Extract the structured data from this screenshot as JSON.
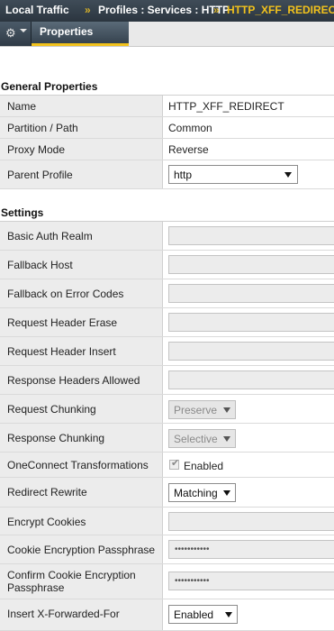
{
  "breadcrumb": {
    "root": "Local Traffic",
    "sep1": "»",
    "section": "Profiles : Services : HTTP",
    "sep2": "»",
    "current": "HTTP_XFF_REDIRECT"
  },
  "toolbar": {
    "gear_icon": "gear-icon",
    "gear_glyph": "⚙",
    "active_tab": "Properties"
  },
  "general": {
    "title": "General Properties",
    "name_label": "Name",
    "name_value": "HTTP_XFF_REDIRECT",
    "partition_label": "Partition / Path",
    "partition_value": "Common",
    "proxy_label": "Proxy Mode",
    "proxy_value": "Reverse",
    "parent_label": "Parent Profile",
    "parent_value": "http"
  },
  "settings": {
    "title": "Settings",
    "basic_auth_label": "Basic Auth Realm",
    "basic_auth_value": "",
    "fallback_host_label": "Fallback Host",
    "fallback_host_value": "",
    "fallback_codes_label": "Fallback on Error Codes",
    "fallback_codes_value": "",
    "req_header_erase_label": "Request Header Erase",
    "req_header_erase_value": "",
    "req_header_insert_label": "Request Header Insert",
    "req_header_insert_value": "",
    "resp_headers_allowed_label": "Response Headers Allowed",
    "resp_headers_allowed_value": "",
    "req_chunking_label": "Request Chunking",
    "req_chunking_value": "Preserve",
    "resp_chunking_label": "Response Chunking",
    "resp_chunking_value": "Selective",
    "oneconnect_label": "OneConnect Transformations",
    "oneconnect_checked": true,
    "oneconnect_value": "Enabled",
    "redirect_label": "Redirect Rewrite",
    "redirect_value": "Matching",
    "encrypt_cookies_label": "Encrypt Cookies",
    "encrypt_cookies_value": "",
    "cookie_pass_label": "Cookie Encryption Passphrase",
    "cookie_pass_value": "•••••••••••",
    "confirm_pass_label": "Confirm Cookie Encryption Passphrase",
    "confirm_pass_value": "•••••••••••",
    "xff_label": "Insert X-Forwarded-For",
    "xff_value": "Enabled"
  }
}
